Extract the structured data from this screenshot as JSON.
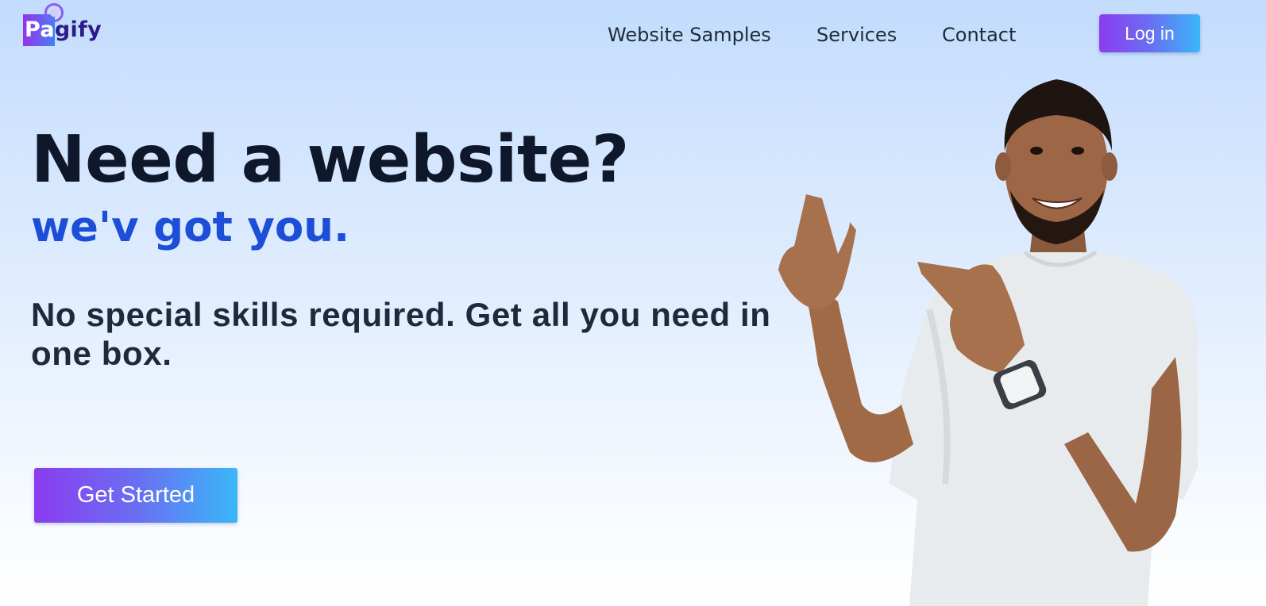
{
  "logo": {
    "text_highlight": "Pa",
    "text_rest": "gify",
    "colors": {
      "box": "#9333ea",
      "text": "#2e1b8a"
    }
  },
  "nav": {
    "links": [
      {
        "label": "Website Samples"
      },
      {
        "label": "Services"
      },
      {
        "label": "Contact"
      }
    ],
    "login_label": "Log in"
  },
  "hero": {
    "headline": "Need a website?",
    "subheadline": "we'v got you.",
    "description": "No special skills required. Get all you need in one box.",
    "cta_label": "Get Started",
    "image_icon": "person-pointing-illustration"
  },
  "colors": {
    "accent_gradient_start": "#8b3cf0",
    "accent_gradient_end": "#3ab7f8",
    "headline": "#0f172a",
    "subheadline": "#1d4ed8",
    "background_top": "#c3dcfd"
  }
}
